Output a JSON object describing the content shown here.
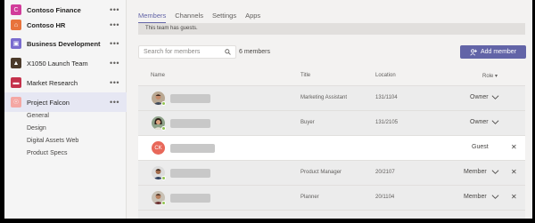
{
  "sidebar": {
    "teams": [
      {
        "label": "Contoso Finance",
        "color": "#d13c9a",
        "glyph": "C",
        "bold": true
      },
      {
        "label": "Contoso HR",
        "color": "#e8733c",
        "glyph": "⌂",
        "bold": true
      },
      {
        "label": "Business Development",
        "color": "#7a6ccf",
        "glyph": "▣",
        "bold": true
      },
      {
        "label": "X1050 Launch Team",
        "color": "#4b3a2a",
        "glyph": "▲",
        "bold": false
      },
      {
        "label": "Market Research",
        "color": "#c4314b",
        "glyph": "▬",
        "bold": false
      },
      {
        "label": "Project Falcon",
        "color": "#f4a7a3",
        "glyph": "☉",
        "bold": false
      }
    ],
    "more_label": "•••",
    "channels": [
      "General",
      "Design",
      "Digital Assets Web",
      "Product Specs"
    ]
  },
  "main": {
    "tabs": [
      "Members",
      "Channels",
      "Settings",
      "Apps"
    ],
    "banner": "This team has guests.",
    "search_placeholder": "Search for members",
    "member_count": "6 members",
    "add_member_label": "Add member",
    "columns": {
      "name": "Name",
      "title": "Title",
      "location": "Location",
      "role": "Role"
    },
    "members": [
      {
        "title": "Marketing Assistant",
        "location": "131/1104",
        "role": "Owner",
        "avatar": "photo-man",
        "presence": "#92c353",
        "removable": false
      },
      {
        "title": "Buyer",
        "location": "131/2105",
        "role": "Owner",
        "avatar": "photo-woman",
        "presence": "#92c353",
        "removable": false
      },
      {
        "title": "",
        "location": "",
        "role": "Guest",
        "avatar_initials": "CK",
        "presence": "",
        "removable": true
      },
      {
        "title": "Product Manager",
        "location": "20/2107",
        "role": "Member",
        "avatar": "photo-man-2",
        "presence": "#92c353",
        "removable": true
      },
      {
        "title": "Planner",
        "location": "20/1104",
        "role": "Member",
        "avatar": "photo-man-3",
        "presence": "#92c353",
        "removable": true
      }
    ],
    "accent_color": "#6264a7"
  }
}
